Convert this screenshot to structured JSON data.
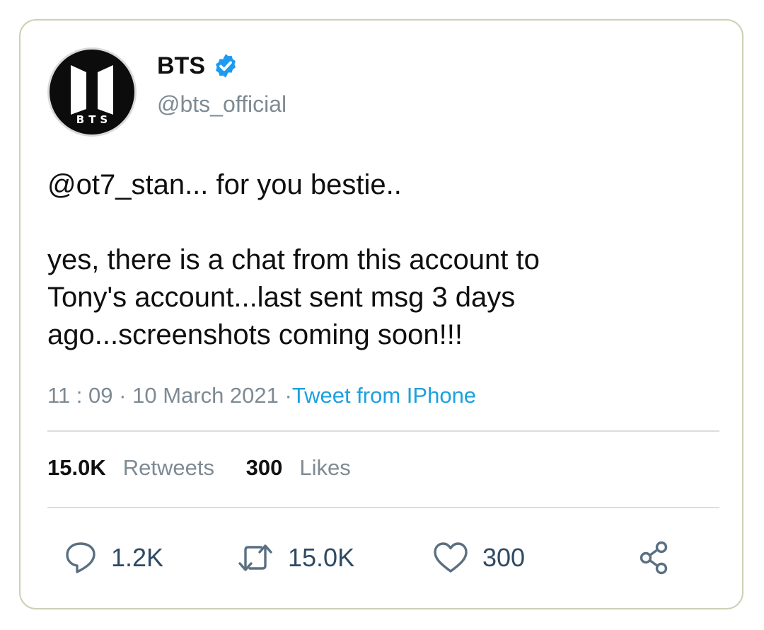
{
  "colors": {
    "border": "#cfcfb6",
    "text": "#111111",
    "muted": "#7e8a93",
    "link": "#1ba0e0",
    "verified": "#1d9bf0",
    "action": "#2f4a63"
  },
  "account": {
    "name": "BTS",
    "handle": "@bts_official",
    "avatar_text": "BTS",
    "verified_icon": "verified-badge-icon"
  },
  "tweet": {
    "line1": "@ot7_stan... for you bestie..",
    "line2": "yes, there is a chat from this account to",
    "line3": "Tony's account...last sent msg 3 days",
    "line4": "ago...screenshots coming soon!!!"
  },
  "meta": {
    "time": "11 : 09",
    "separator": "·",
    "date": "10 March 2021",
    "source_prefix": "·",
    "source": "Tweet from IPhone"
  },
  "stats": {
    "retweets_count": "15.0K",
    "retweets_label": "Retweets",
    "likes_count": "300",
    "likes_label": "Likes"
  },
  "actions": {
    "reply_count": "1.2K",
    "retweet_count": "15.0K",
    "like_count": "300",
    "icons": [
      "reply-icon",
      "retweet-icon",
      "like-icon",
      "share-icon"
    ]
  }
}
